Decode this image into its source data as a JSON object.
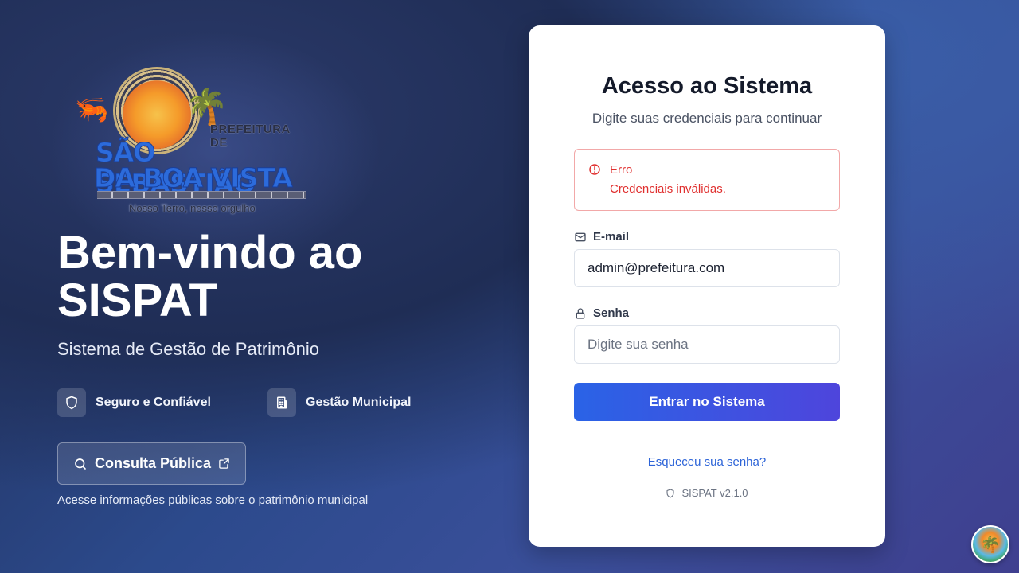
{
  "logo": {
    "prefeitura": "PREFEITURA DE",
    "name_line1": "SÃO SEBASTIÃO",
    "name_line2": "DA BOA VISTA",
    "motto": "Nosso Terro, nosso orgulho"
  },
  "hero": {
    "title": "Bem-vindo ao SISPAT",
    "subtitle": "Sistema de Gestão de Patrimônio"
  },
  "features": [
    {
      "label": "Seguro e Confiável",
      "icon": "shield-icon"
    },
    {
      "label": "Gestão Municipal",
      "icon": "building-icon"
    }
  ],
  "consulta": {
    "label": "Consulta Pública",
    "note": "Acesse informações públicas sobre o patrimônio municipal"
  },
  "card": {
    "title": "Acesso ao Sistema",
    "subtitle": "Digite suas credenciais para continuar",
    "alert": {
      "title": "Erro",
      "message": "Credenciais inválidas."
    },
    "email": {
      "label": "E-mail",
      "value": "admin@prefeitura.com",
      "placeholder": ""
    },
    "password": {
      "label": "Senha",
      "value": "",
      "placeholder": "Digite sua senha"
    },
    "submit_label": "Entrar no Sistema",
    "forgot_label": "Esqueceu sua senha?",
    "version": "SISPAT v2.1.0"
  },
  "colors": {
    "accent": "#2a63e6",
    "accent_end": "#4e45dc",
    "error": "#e0302f",
    "link": "#2d64d8"
  }
}
